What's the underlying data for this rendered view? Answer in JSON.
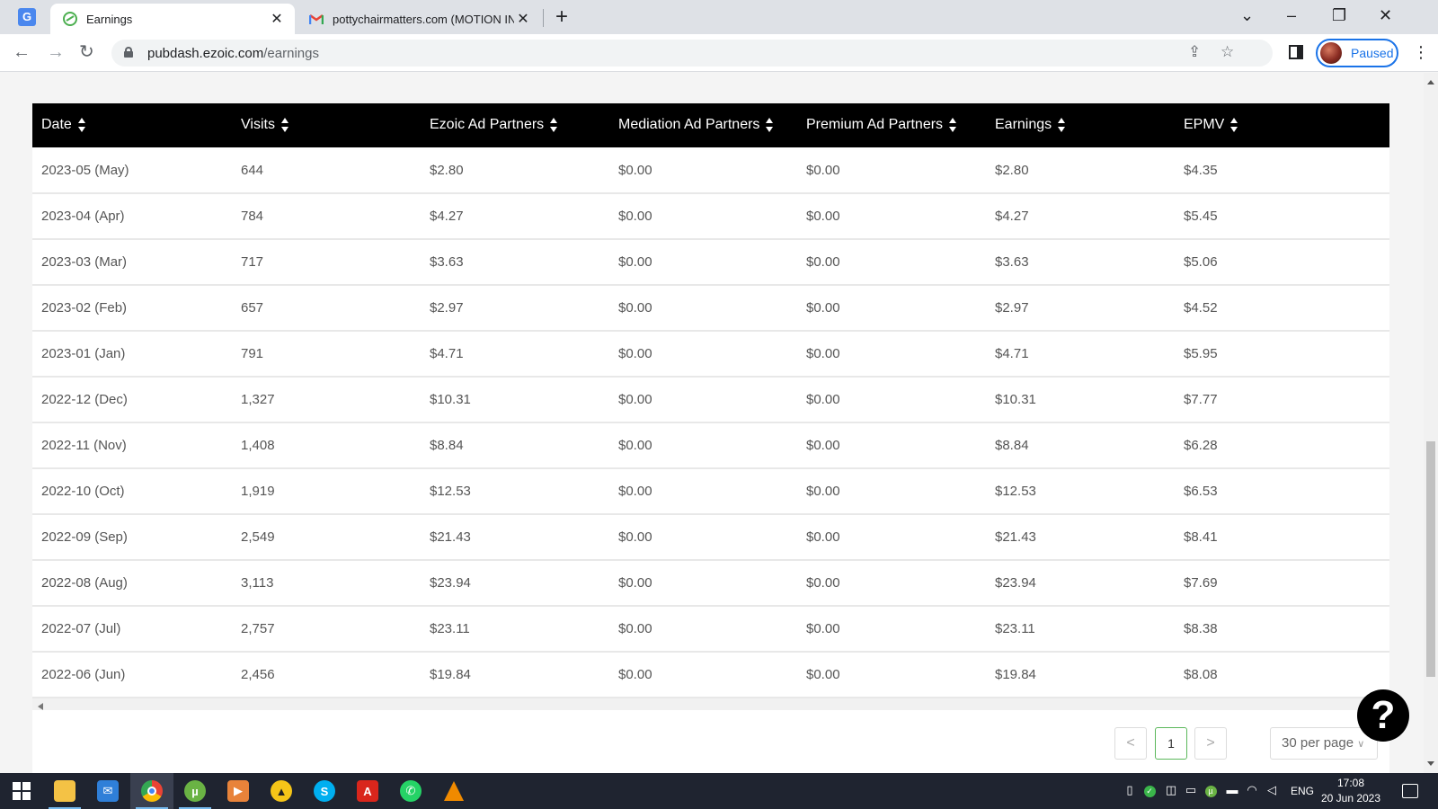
{
  "browser": {
    "tabs": [
      {
        "title": "Earnings",
        "active": true,
        "favicon": "ezoic-icon"
      },
      {
        "title": "pottychairmatters.com (MOTION IN",
        "active": false,
        "favicon": "gmail-icon"
      }
    ],
    "url_host": "pubdash.ezoic.com",
    "url_path": "/earnings",
    "profile_label": "Paused"
  },
  "table": {
    "columns": [
      "Date",
      "Visits",
      "Ezoic Ad Partners",
      "Mediation Ad Partners",
      "Premium Ad Partners",
      "Earnings",
      "EPMV"
    ],
    "rows": [
      [
        "2023-05 (May)",
        "644",
        "$2.80",
        "$0.00",
        "$0.00",
        "$2.80",
        "$4.35"
      ],
      [
        "2023-04 (Apr)",
        "784",
        "$4.27",
        "$0.00",
        "$0.00",
        "$4.27",
        "$5.45"
      ],
      [
        "2023-03 (Mar)",
        "717",
        "$3.63",
        "$0.00",
        "$0.00",
        "$3.63",
        "$5.06"
      ],
      [
        "2023-02 (Feb)",
        "657",
        "$2.97",
        "$0.00",
        "$0.00",
        "$2.97",
        "$4.52"
      ],
      [
        "2023-01 (Jan)",
        "791",
        "$4.71",
        "$0.00",
        "$0.00",
        "$4.71",
        "$5.95"
      ],
      [
        "2022-12 (Dec)",
        "1,327",
        "$10.31",
        "$0.00",
        "$0.00",
        "$10.31",
        "$7.77"
      ],
      [
        "2022-11 (Nov)",
        "1,408",
        "$8.84",
        "$0.00",
        "$0.00",
        "$8.84",
        "$6.28"
      ],
      [
        "2022-10 (Oct)",
        "1,919",
        "$12.53",
        "$0.00",
        "$0.00",
        "$12.53",
        "$6.53"
      ],
      [
        "2022-09 (Sep)",
        "2,549",
        "$21.43",
        "$0.00",
        "$0.00",
        "$21.43",
        "$8.41"
      ],
      [
        "2022-08 (Aug)",
        "3,113",
        "$23.94",
        "$0.00",
        "$0.00",
        "$23.94",
        "$7.69"
      ],
      [
        "2022-07 (Jul)",
        "2,757",
        "$23.11",
        "$0.00",
        "$0.00",
        "$23.11",
        "$8.38"
      ],
      [
        "2022-06 (Jun)",
        "2,456",
        "$19.84",
        "$0.00",
        "$0.00",
        "$19.84",
        "$8.08"
      ]
    ]
  },
  "pagination": {
    "prev": "<",
    "current": "1",
    "next": ">",
    "per_page": "30 per page"
  },
  "help": {
    "label": "?"
  },
  "taskbar": {
    "language": "ENG",
    "time": "17:08",
    "date": "20 Jun 2023"
  }
}
